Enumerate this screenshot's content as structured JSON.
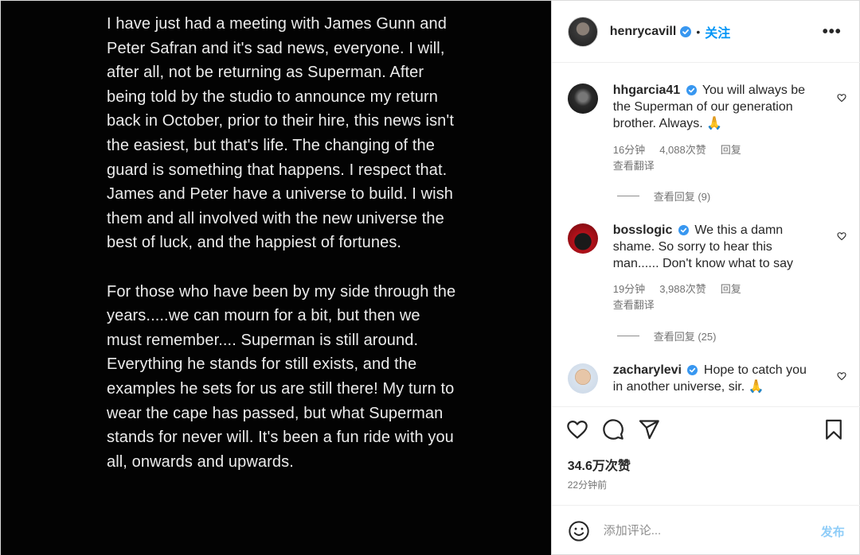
{
  "colors": {
    "media_background": "#030303",
    "media_text": "#ececec",
    "verified_badge": "#3897f0",
    "follow_link": "#0095f6",
    "secondary_text": "#737373",
    "post_button_disabled": "#8fcdf8"
  },
  "media": {
    "paragraphs": [
      "I have just had a meeting with James Gunn and Peter Safran and it's sad news, everyone. I will, after all, not be returning as Superman. After being told by the studio to announce my return back in October, prior to their hire, this news isn't the easiest, but that's life. The changing of the guard is something that happens. I respect that. James and Peter have a universe to build. I wish them and all involved with the new universe the best of luck, and the happiest of fortunes.",
      "For those who have been by my side through the years.....we can mourn for a bit, but then we must remember.... Superman is still around. Everything he stands for still exists, and the examples he sets for us are still there! My turn to wear the cape has passed, but what Superman stands for never will. It's been a fun ride with you all, onwards and upwards."
    ]
  },
  "header": {
    "username": "henrycavill",
    "separator": "•",
    "follow_label": "关注",
    "more_label": "•••",
    "verified_icon": "verified-badge-icon"
  },
  "comments": [
    {
      "username": "hhgarcia41",
      "text": "You will always be the Superman of our generation brother. Always. 🙏",
      "time": "16分钟",
      "likes": "4,088次赞",
      "reply_label": "回复",
      "translate_label": "查看翻译",
      "view_replies": "查看回复 (9)"
    },
    {
      "username": "bosslogic",
      "text": "We this a damn shame. So sorry to hear this man...... Don't know what to say",
      "time": "19分钟",
      "likes": "3,988次赞",
      "reply_label": "回复",
      "translate_label": "查看翻译",
      "view_replies": "查看回复 (25)"
    },
    {
      "username": "zacharylevi",
      "text": "Hope to catch you in another universe, sir. 🙏"
    }
  ],
  "actions": {
    "like_icon": "heart-icon",
    "comment_icon": "comment-bubble-icon",
    "share_icon": "paper-plane-icon",
    "save_icon": "bookmark-icon",
    "likes_count": "34.6万次赞",
    "posted_time": "22分钟前"
  },
  "add_comment": {
    "emoji_icon": "smiley-icon",
    "placeholder": "添加评论...",
    "post_label": "发布"
  }
}
